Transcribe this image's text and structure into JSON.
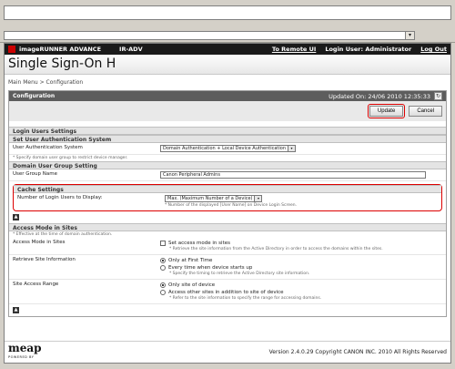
{
  "browser": {
    "dropdown_glyph": "▾"
  },
  "topbar": {
    "brand": "imageRUNNER ADVANCE",
    "device": "IR-ADV",
    "to_remote_ui": "To Remote UI",
    "login_user": "Login User: Administrator",
    "log_out": "Log Out"
  },
  "page": {
    "title": "Single Sign-On H"
  },
  "breadcrumb": "Main Menu > Configuration",
  "panel": {
    "title": "Configuration",
    "updated_on": "Updated On: 24/06 2010 12:35:33",
    "update_label": "Update",
    "cancel_label": "Cancel"
  },
  "login_users_settings": {
    "title": "Login Users Settings",
    "set_user_auth": {
      "title": "Set User Authentication System",
      "user_auth_system_label": "User Authentication System",
      "user_auth_system_value": "Domain Authentication + Local Device Authentication",
      "note": "* Specify domain user group to restrict device manager."
    },
    "domain_user_group": {
      "title": "Domain User Group Setting",
      "label": "User Group Name",
      "value": "Canon Peripheral Admins"
    },
    "cache": {
      "title": "Cache Settings",
      "label": "Number of Login Users to Display:",
      "value": "Max. (Maximum Number of a Device)",
      "note": "* Number of the displayed [User Name] on Device Login Screen."
    }
  },
  "access_mode": {
    "title": "Access Mode in Sites",
    "note": "* Effective at the time of domain authentication.",
    "access_mode_label": "Access Mode in Sites",
    "set_access_mode": "Set access mode in sites",
    "set_access_note": "* Retrieve the site information from the Active Directory in order to access the domains within the sites.",
    "retrieve_label": "Retrieve Site Information",
    "only_first_time": "Only at First Time",
    "every_time": "Every time when device starts up",
    "retrieve_note": "* Specify the timing to retrieve the Active Directory site information.",
    "site_range_label": "Site Access Range",
    "only_site_of_device": "Only site of device",
    "access_other_sites": "Access other sites in addition to site of device",
    "range_note": "* Refer to the site information to specify the range for accessing domains."
  },
  "footer": {
    "logo": "meap",
    "logo_sub": "POWERED BY",
    "copyright": "Version 2.4.0.29 Copyright CANON INC. 2010 All Rights Reserved"
  }
}
